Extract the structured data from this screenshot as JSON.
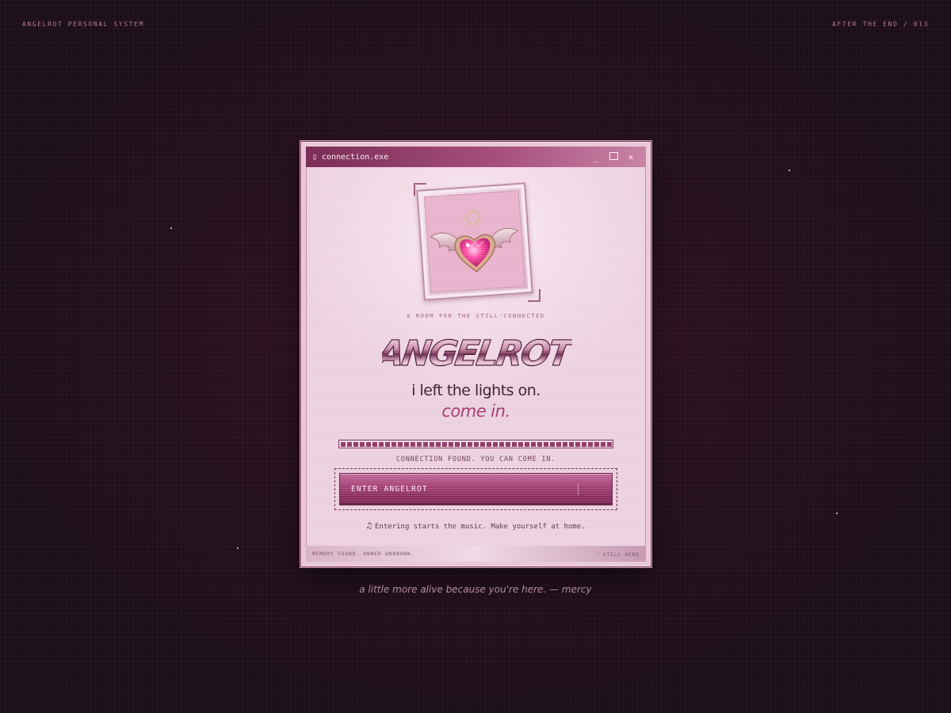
{
  "corners": {
    "left": "ANGELROT PERSONAL SYSTEM",
    "right": "AFTER THE END / 013"
  },
  "window": {
    "icon": "window-icon",
    "title": "connection.exe",
    "minimize_glyph": "_",
    "close_glyph": "×"
  },
  "hero": {
    "image": "winged-heart-charm",
    "tagline": "A ROOM FOR THE STILL-CONNECTED",
    "logo_text": "ANGELROT",
    "line1": "i left the lights on.",
    "line2": "come in."
  },
  "connection": {
    "progress": 1.0,
    "status": "CONNECTION FOUND. YOU CAN COME IN.",
    "enter_label": "ENTER ANGELROT",
    "hint_icon": "♫",
    "hint": "Entering starts the music. Make yourself at home."
  },
  "footer": {
    "left": "MEMORY FOUND. OWNER UNKNOWN.",
    "right_icon": "♡",
    "right": "STILL HERE"
  },
  "caption": "a little more alive because you're here. — mercy",
  "colors": {
    "accent": "#a33a6e",
    "window_bg": "#f3dce8",
    "titlebar": "#7a2e56",
    "background": "#1d0f19"
  }
}
